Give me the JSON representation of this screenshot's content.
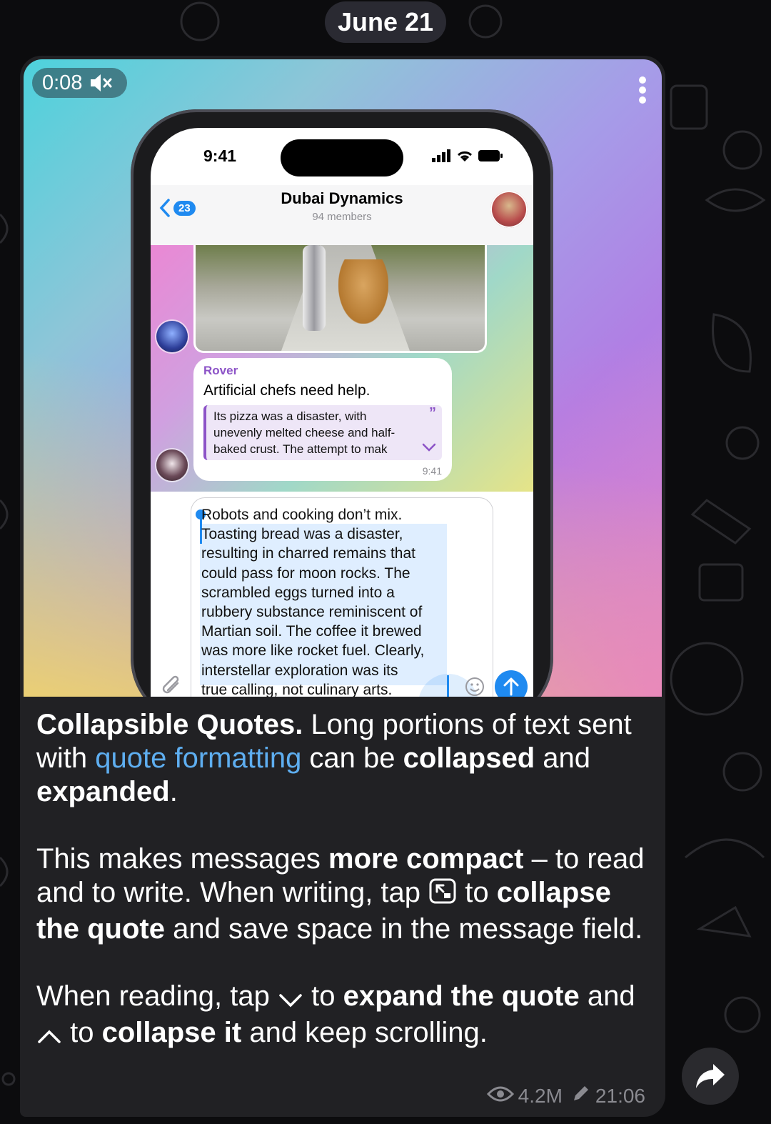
{
  "date_label": "June 21",
  "media": {
    "duration": "0:08",
    "muted_icon": "speaker-muted-icon",
    "menu_icon": "more-vertical-icon"
  },
  "phone": {
    "time": "9:41",
    "chat_title": "Dubai Dynamics",
    "chat_subtitle": "94 members",
    "back_count": "23",
    "bubble": {
      "sender": "Rover",
      "text": "Artificial chefs need help.",
      "quote_lines": [
        "Its pizza was a disaster, with",
        "unevenly melted cheese and half-",
        "baked crust. The attempt to mak"
      ],
      "time": "9:41"
    },
    "input_text": "Robots and cooking don’t mix.\nToasting bread was a disaster,\nresulting in charred remains that\ncould pass for moon rocks. The\nscrambled eggs turned into a\nrubbery substance reminiscent of\nMartian soil. The coffee it brewed\nwas more like rocket fuel. Clearly,\ninterstellar exploration was its\ntrue calling, not culinary arts."
  },
  "caption": {
    "p1": {
      "title": "Collapsible Quotes.",
      "t1": " Long portions of text sent with ",
      "link": "quote formatting",
      "t2": " can be ",
      "b1": "collapsed",
      "t3": " and ",
      "b2": "expanded",
      "t4": "."
    },
    "p2": {
      "t1": "This makes messages ",
      "b1": "more compact",
      "t2": " – to read and to write. When writing, tap ",
      "t3": " to ",
      "b2": "collapse the quote",
      "t4": " and save space in the message field."
    },
    "p3": {
      "t1": "When reading, tap ",
      "t2": " to ",
      "b1": "expand the quote",
      "t3": " and ",
      "t4": " to ",
      "b2": "collapse it",
      "t5": " and keep scrolling."
    }
  },
  "meta": {
    "views": "4.2M",
    "time": "21:06"
  },
  "colors": {
    "link": "#5eaef0",
    "card": "#212124",
    "accent": "#1f8af0"
  }
}
